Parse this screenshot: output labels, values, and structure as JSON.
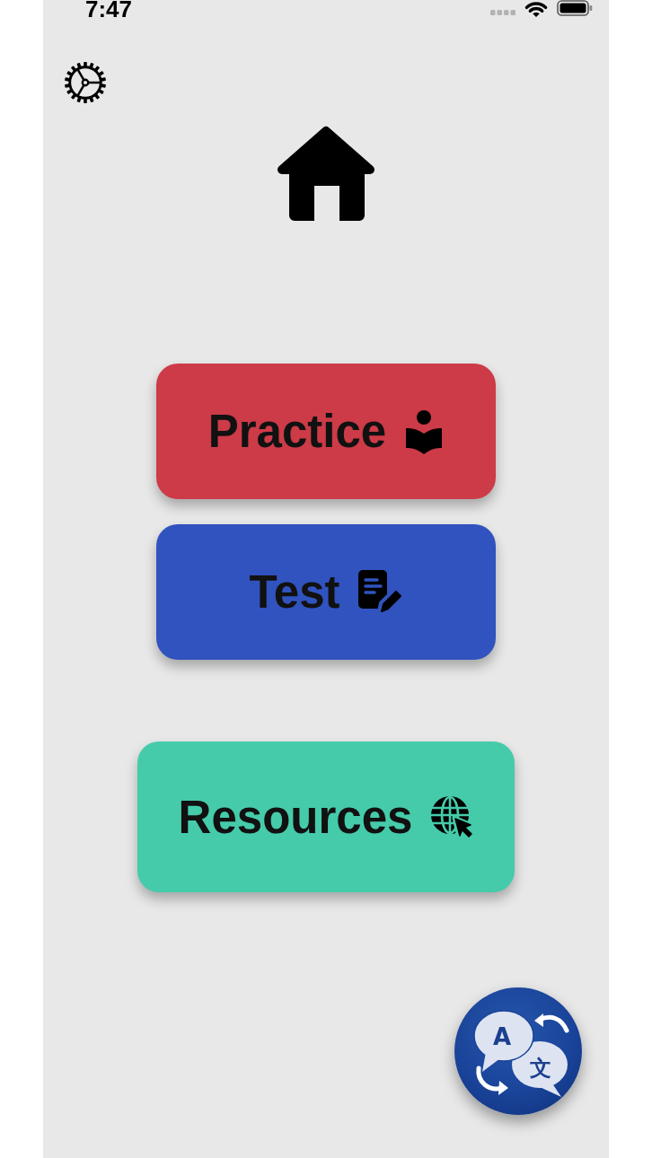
{
  "status_bar": {
    "time": "7:47"
  },
  "menu_buttons": [
    {
      "kind": "practice",
      "label": "Practice",
      "color": "#cc3b47"
    },
    {
      "kind": "test",
      "label": "Test",
      "color": "#3153bf"
    },
    {
      "kind": "resources",
      "label": "Resources",
      "color": "#45cbaa"
    }
  ],
  "translate_button": {
    "glyphs": [
      "A",
      "文"
    ]
  }
}
